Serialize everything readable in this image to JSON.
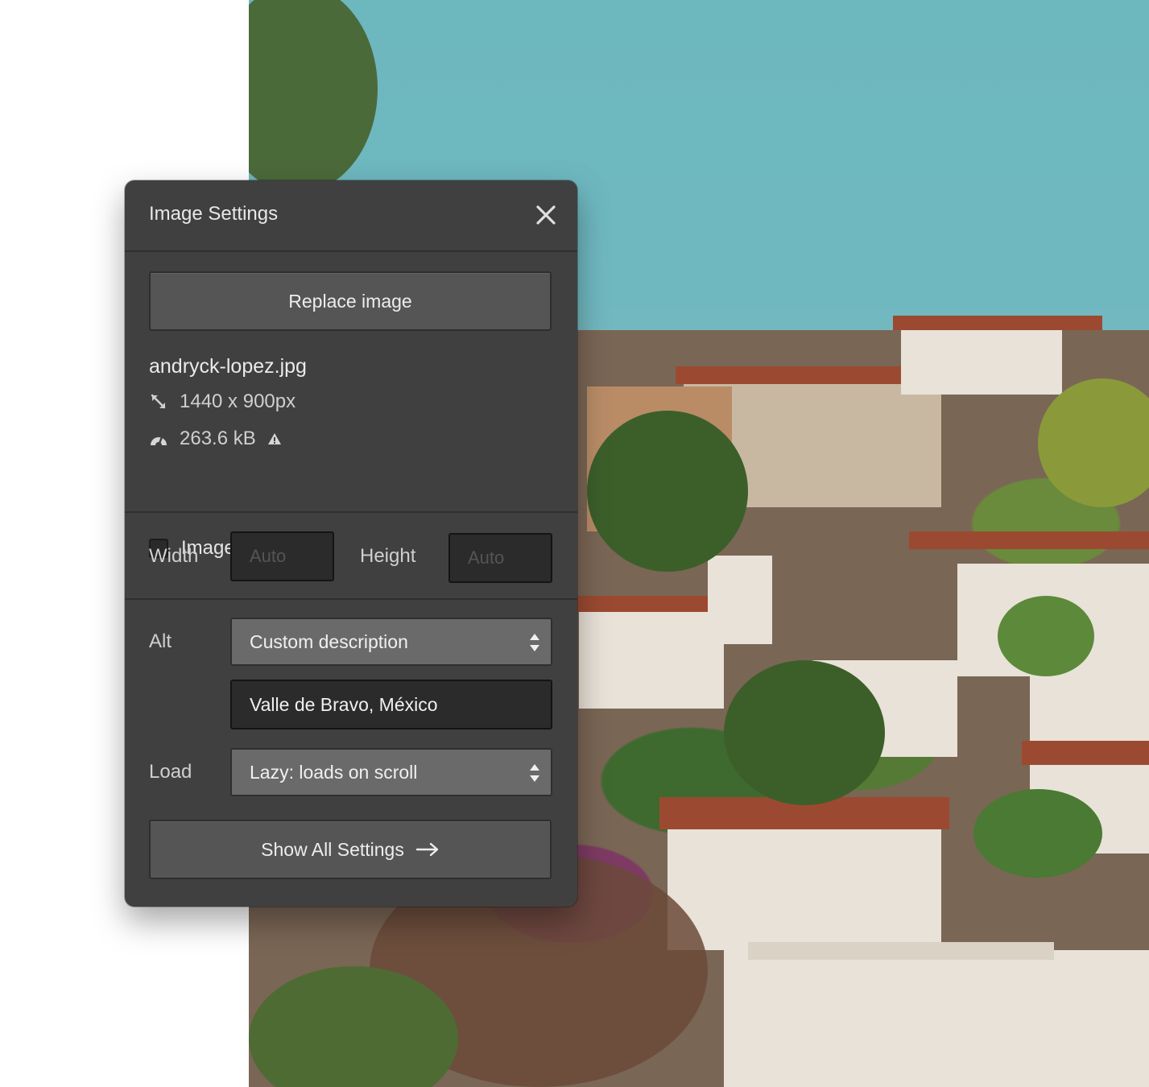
{
  "panel": {
    "title": "Image Settings",
    "replace_label": "Replace image",
    "filename": "andryck-lopez.jpg",
    "dimensions": "1440 x 900px",
    "file_size": "263.6 kB",
    "hidpi_label": "Image is HiDPI",
    "hidpi_checked": false
  },
  "size": {
    "width_label": "Width",
    "width_placeholder": "Auto",
    "height_label": "Height",
    "height_placeholder": "Auto"
  },
  "alt": {
    "label": "Alt",
    "mode": "Custom description",
    "value": "Valle de Bravo, México"
  },
  "load": {
    "label": "Load",
    "value": "Lazy: loads on scroll"
  },
  "footer": {
    "show_all_label": "Show All Settings"
  },
  "icons": {
    "close": "close-icon",
    "resize": "resize-icon",
    "gauge": "gauge-icon",
    "warning": "warning-icon",
    "select_arrows": "updown-arrows-icon",
    "arrow_right": "arrow-right-icon"
  },
  "colors": {
    "panel_bg": "#404040",
    "button_bg": "#555555",
    "input_bg": "#2b2b2b",
    "select_bg": "#6a6a6a",
    "sky": "#6db7bf"
  }
}
